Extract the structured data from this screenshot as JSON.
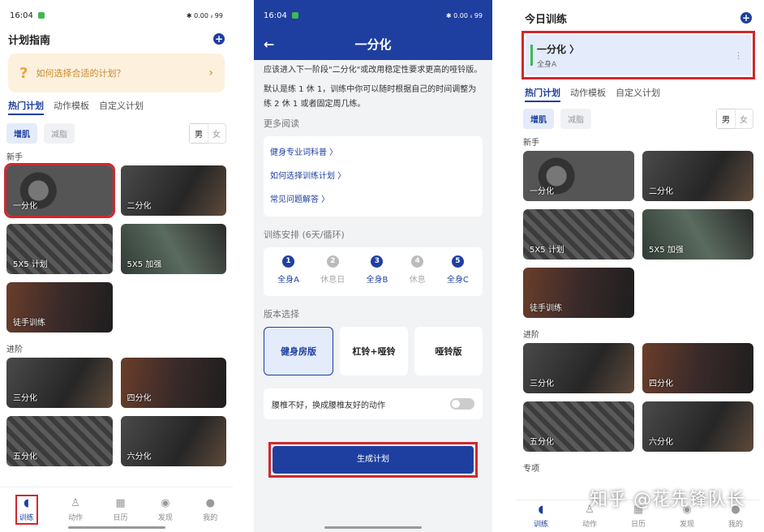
{
  "p1": {
    "time": "16:04",
    "status_icons": "✱ 0.00 ᵢₗ 99",
    "title": "计划指南",
    "banner": "如何选择合适的计划？",
    "tabs": [
      "热门计划",
      "动作模板",
      "自定义计划"
    ],
    "chips": [
      "增肌",
      "减脂"
    ],
    "gender": [
      "男",
      "女"
    ],
    "sections": [
      "新手",
      "进阶"
    ],
    "beginner": [
      "一分化",
      "二分化",
      "5X5 计划",
      "5X5 加强",
      "徒手训练"
    ],
    "advanced": [
      "三分化",
      "四分化",
      "五分化",
      "六分化"
    ],
    "nav": [
      "训练",
      "动作",
      "日历",
      "发现",
      "我的"
    ]
  },
  "p2": {
    "time": "16:04",
    "title": "一分化",
    "para1": "应该进入下一阶段\"二分化\"或改用稳定性要求更高的哑铃版。",
    "para2": "默认是练 1 休 1，训练中你可以随时根据自己的时间调整为练 2 休 1 或者固定周几练。",
    "more": "更多阅读",
    "links": [
      "健身专业词科普 〉",
      "如何选择训练计划 〉",
      "常见问题解答 〉"
    ],
    "schedule": "训练安排 (6天/循环)",
    "days": [
      {
        "n": "1",
        "label": "全身A"
      },
      {
        "n": "2",
        "label": "休息日"
      },
      {
        "n": "3",
        "label": "全身B"
      },
      {
        "n": "4",
        "label": "休息"
      },
      {
        "n": "5",
        "label": "全身C"
      }
    ],
    "version": "版本选择",
    "versions": [
      "健身房版",
      "杠铃+哑铃",
      "哑铃版"
    ],
    "toggle": "腰椎不好，换成腰椎友好的动作",
    "generate": "生成计划"
  },
  "p3": {
    "title": "今日训练",
    "today_name": "一分化 〉",
    "today_sub": "全身A",
    "tabs": [
      "热门计划",
      "动作模板",
      "自定义计划"
    ],
    "chips": [
      "增肌",
      "减脂"
    ],
    "gender": [
      "男",
      "女"
    ],
    "sections": [
      "新手",
      "进阶"
    ],
    "beginner": [
      "一分化",
      "二分化",
      "5X5 计划",
      "5X5 加强",
      "徒手训练"
    ],
    "advanced": [
      "三分化",
      "四分化",
      "五分化",
      "六分化"
    ],
    "extra_section": "专项",
    "nav": [
      "训练",
      "动作",
      "日历",
      "发现",
      "我的"
    ],
    "watermark": "知乎 @花先锋队长"
  }
}
